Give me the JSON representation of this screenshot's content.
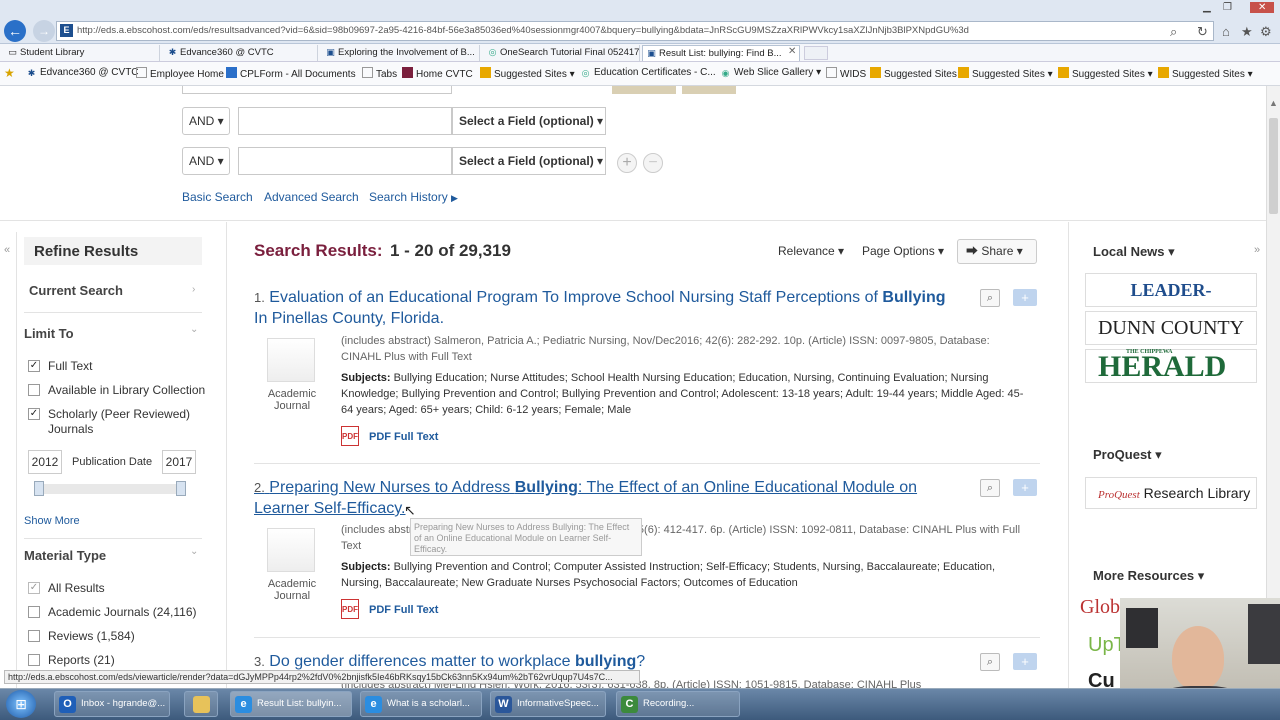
{
  "browser": {
    "url": "http://eds.a.ebscohost.com/eds/resultsadvanced?vid=6&sid=98b09697-2a95-4216-84bf-56e3a85036ed%40sessionmgr4007&bquery=bullying&bdata=JnRScGU9MSZzaXRlPWVkcy1saXZlJnNjb3BlPXNpdGU%3d",
    "tabs": [
      "Student Library",
      "Edvance360 @ CVTC",
      "Exploring the Involvement of B...",
      "OneSearch Tutorial Final 052417",
      "Result List: bullying: Find B..."
    ],
    "favorites": [
      "Edvance360 @ CVTC",
      "Employee Home",
      "CPLForm - All Documents",
      "Tabs",
      "Home CVTC",
      "Suggested Sites",
      "Education Certificates - C...",
      "Web Slice Gallery",
      "WIDS",
      "Suggested Sites",
      "Suggested Sites",
      "Suggested Sites",
      "Suggested Sites"
    ],
    "status_url": "http://eds.a.ebscohost.com/eds/viewarticle/render?data=dGJyMPPp44rp2%2fdV0%2bnjisfk5Ie46bRKsqy15bCk63nn5Kx94um%2bT62vrUqup7U4s7C..."
  },
  "search": {
    "rows": [
      {
        "bool": "AND",
        "term": "",
        "field": "Select a Field (optional)"
      },
      {
        "bool": "AND",
        "term": "",
        "field": "Select a Field (optional)"
      }
    ],
    "links": {
      "basic": "Basic Search",
      "advanced": "Advanced Search",
      "history": "Search History"
    }
  },
  "refine": {
    "title": "Refine Results",
    "current_search": "Current Search",
    "limit_to": "Limit To",
    "limits": [
      {
        "label": "Full Text",
        "checked": true
      },
      {
        "label": "Available in Library Collection",
        "checked": false
      },
      {
        "label": "Scholarly (Peer Reviewed) Journals",
        "checked": true
      }
    ],
    "pub_date": {
      "label": "Publication Date",
      "from": "2012",
      "to": "2017"
    },
    "show_more": "Show More",
    "material_type": "Material Type",
    "materials": [
      {
        "label": "All Results",
        "checked": true
      },
      {
        "label": "Academic Journals (24,116)",
        "checked": false
      },
      {
        "label": "Reviews (1,584)",
        "checked": false
      },
      {
        "label": "Reports (21)",
        "checked": false
      }
    ]
  },
  "results": {
    "heading": "Search Results:",
    "range": "1 - 20 of 29,319",
    "relevance": "Relevance",
    "page_options": "Page Options",
    "share": "Share",
    "items": [
      {
        "num": "1.",
        "title_pre": "Evaluation of an Educational Program To Improve School Nursing Staff Perceptions of ",
        "title_bold": "Bullying",
        "title_post": " In Pinellas County, Florida.",
        "meta": "(includes abstract) Salmeron, Patricia A.; Pediatric Nursing, Nov/Dec2016; 42(6): 282-292. 10p. (Article) ISSN: 0097-9805, Database: CINAHL Plus with Full Text",
        "subjects_label": "Subjects:",
        "subjects": "Bullying Education; Nurse Attitudes; School Health Nursing Education; Education, Nursing, Continuing Evaluation; Nursing Knowledge; Bullying Prevention and Control; Bullying Prevention and Control; Adolescent: 13-18 years; Adult: 19-44 years; Middle Aged: 45-64 years; Aged: 65+ years; Child: 6-12 years; Female; Male",
        "type": "Academic Journal",
        "fulltext": "PDF Full Text"
      },
      {
        "num": "2.",
        "title_pre": "Preparing New Nurses to Address ",
        "title_bold": "Bullying",
        "title_post": ": The Effect of an Online Educational Module on Learner Self-Efficacy.",
        "meta": "(includes abstract) Tyler S.; Nurse Educator, Nov/Dec2016; 25(6): 412-417. 6p. (Article) ISSN: 1092-0811, Database: CINAHL Plus with Full Text",
        "subjects_label": "Subjects:",
        "subjects": "Bullying Prevention and Control; Computer Assisted Instruction; Self-Efficacy; Students, Nursing, Baccalaureate; Education, Nursing, Baccalaureate; New Graduate Nurses Psychosocial Factors; Outcomes of Education",
        "type": "Academic Journal",
        "fulltext": "PDF Full Text",
        "tooltip": "Preparing New Nurses to Address Bullying: The Effect of an Online Educational Module on Learner Self-Efficacy."
      },
      {
        "num": "3.",
        "title_pre": "Do gender differences matter to workplace ",
        "title_bold": "bullying",
        "title_post": "?",
        "meta": "(includes abstract) Mei-Ling Hsieh; Work, 2016; 53(3): 631-638. 8p. (Article) ISSN: 1051-9815, Database: CINAHL Plus"
      }
    ]
  },
  "rightpanel": {
    "local_news": "Local News",
    "papers": [
      "LEADER-TELEGRAM",
      "DUNN COUNTY NEWS",
      "HERALD"
    ],
    "herald_small": "THE CHIPPEWA",
    "proquest": "ProQuest",
    "proquest_logo": "ProQuest",
    "proquest_lib": "Research Library",
    "more_resources": "More Resources",
    "more_items": [
      "Global Road Warrior",
      "UpTo",
      "Cu"
    ]
  },
  "taskbar": {
    "items": [
      "Inbox - hgrande@...",
      "Result List: bullyin...",
      "What is a scholarl...",
      "InformativeSpeec...",
      "Recording..."
    ]
  },
  "colors": {
    "accent": "#1f5a9c",
    "heading": "#7a1f3d"
  }
}
